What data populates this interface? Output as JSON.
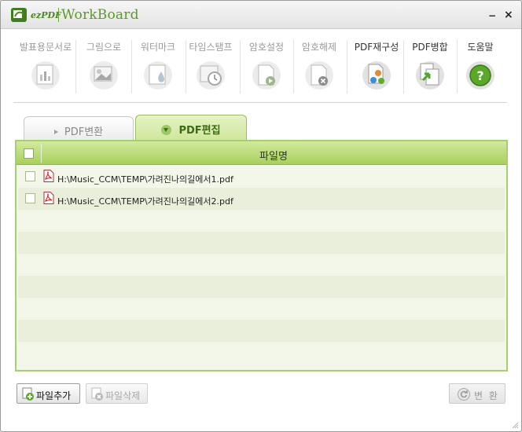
{
  "window": {
    "brand_ez": "ezPDF",
    "brand_name": "WorkBoard",
    "minimize_label": "−",
    "close_label": "×"
  },
  "toolbar": {
    "items": [
      {
        "label": "발표용문서로",
        "icon": "presentation-icon",
        "enabled": false
      },
      {
        "label": "그림으로",
        "icon": "image-icon",
        "enabled": false
      },
      {
        "label": "워터마크",
        "icon": "watermark-icon",
        "enabled": false
      },
      {
        "label": "타임스탬프",
        "icon": "timestamp-icon",
        "enabled": false
      },
      {
        "label": "암호설정",
        "icon": "lock-icon",
        "enabled": false
      },
      {
        "label": "암호해제",
        "icon": "unlock-icon",
        "enabled": false
      },
      {
        "label": "PDF재구성",
        "icon": "restructure-icon",
        "enabled": true
      },
      {
        "label": "PDF병합",
        "icon": "merge-icon",
        "enabled": true
      },
      {
        "label": "도움말",
        "icon": "help-icon",
        "enabled": true
      }
    ]
  },
  "tabs": [
    {
      "label": "PDF변환",
      "active": false
    },
    {
      "label": "PDF편집",
      "active": true
    }
  ],
  "file_list": {
    "header": "파일명",
    "files": [
      {
        "name": "H:\\Music_CCM\\TEMP\\가려진나의길에서1.pdf",
        "checked": false
      },
      {
        "name": "H:\\Music_CCM\\TEMP\\가려진나의길에서2.pdf",
        "checked": false
      }
    ],
    "empty_rows": 7
  },
  "buttons": {
    "add": "파일추가",
    "delete": "파일삭제",
    "convert": "변 환"
  },
  "colors": {
    "accent_green": "#a8d05c",
    "tab_active_text": "#3b6b12",
    "disabled_text": "#9a9a9a"
  }
}
